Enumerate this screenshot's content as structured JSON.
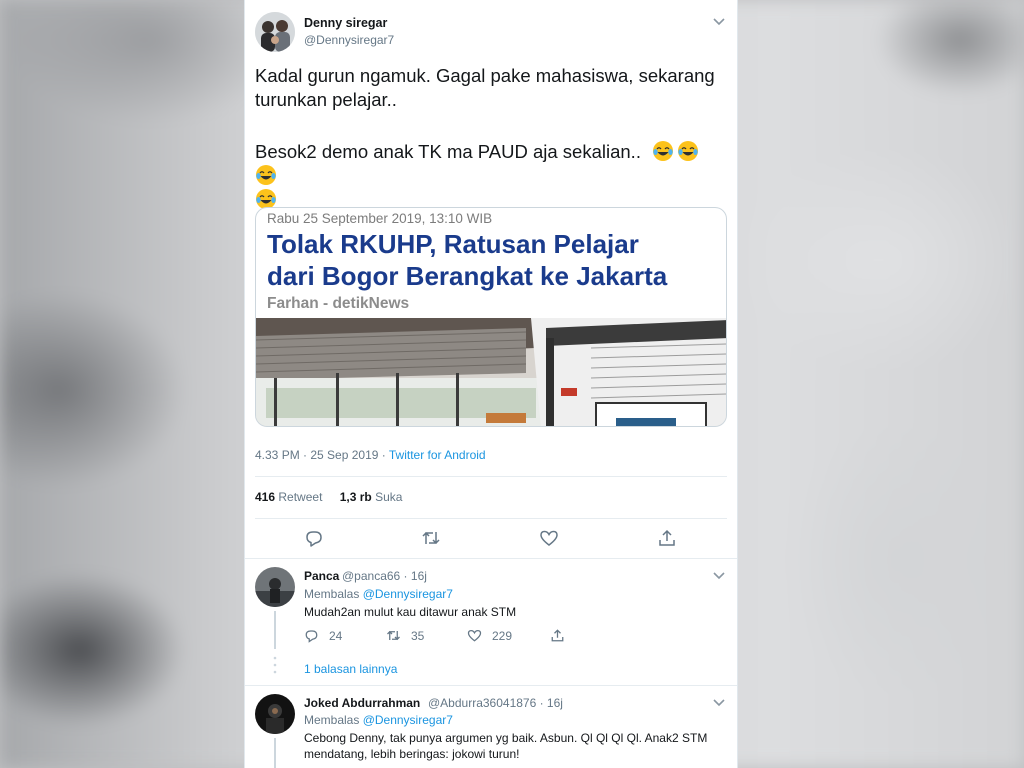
{
  "tweet": {
    "author_name": "Denny siregar",
    "author_handle": "@Dennysiregar7",
    "text_line1": "Kadal gurun ngamuk. Gagal pake mahasiswa, sekarang",
    "text_line2": "turunkan pelajar..",
    "text_line3": "Besok2 demo anak TK ma PAUD aja sekalian..",
    "emoji_count": 4,
    "embed": {
      "date": "Rabu 25 September 2019, 13:10 WIB",
      "title_line1": "Tolak RKUHP, Ratusan Pelajar",
      "title_line2": "dari Bogor Berangkat ke Jakarta",
      "author": "Farhan - detikNews"
    },
    "time": "4.33 PM · 25 Sep 2019 · ",
    "source": "Twitter for Android",
    "retweets": "416",
    "retweets_label": "Retweet",
    "likes": "1,3 rb",
    "likes_label": "Suka"
  },
  "replies": [
    {
      "name": "Panca",
      "handle": "@panca66 · 16j",
      "replying_label": "Membalas ",
      "replying_to": "@Dennysiregar7",
      "text": "Mudah2an mulut kau ditawur anak STM",
      "reply_count": "24",
      "retweet_count": "35",
      "like_count": "229",
      "more_replies": "1 balasan lainnya"
    },
    {
      "name": "Joked Abdurrahman",
      "handle": "@Abdurra36041876 · 16j",
      "replying_label": "Membalas ",
      "replying_to": "@Dennysiregar7",
      "text_line1": "Cebong Denny, tak punya argumen yg baik. Asbun. Ql Ql Ql Ql. Anak2 STM",
      "text_line2": "mendatang, lebih beringas: jokowi turun!"
    }
  ],
  "colors": {
    "link": "#1b95e0",
    "text": "#14171a",
    "muted": "#657786",
    "embed_title": "#1a3b8c"
  }
}
